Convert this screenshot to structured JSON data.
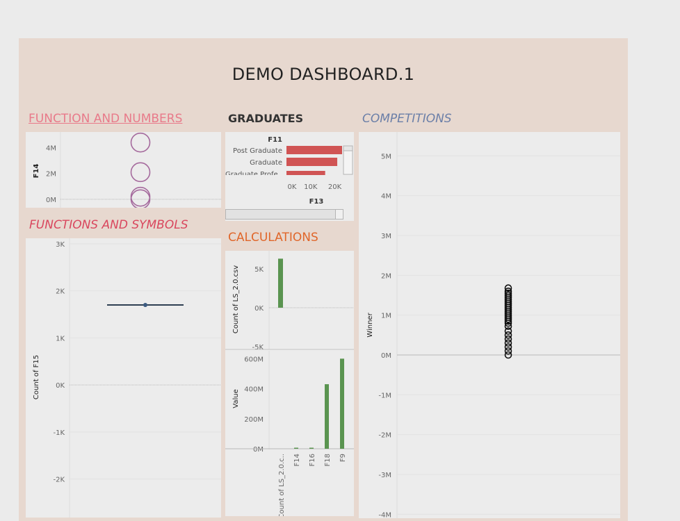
{
  "dashboard": {
    "title": "DEMO DASHBOARD.1"
  },
  "sections": {
    "function_numbers": {
      "title": "FUNCTION AND NUMBERS",
      "color": "#e87a8a"
    },
    "graduates": {
      "title": "GRADUATES",
      "color": "#333333"
    },
    "competitions": {
      "title": "COMPETITIONS",
      "color": "#6b7fa8"
    },
    "functions_symbols": {
      "title": "FUNCTIONS  AND SYMBOLS",
      "color": "#d9475e"
    },
    "calculations": {
      "title": "CALCULATIONS",
      "color": "#e0662a"
    }
  },
  "colors": {
    "ring": "#a56a9d",
    "bar_red": "#d05454",
    "bar_green": "#5a9450",
    "line": "#2e3f52"
  },
  "chart_data": [
    {
      "id": "f14",
      "type": "scatter",
      "ylabel": "F14",
      "y_ticks": [
        "4M",
        "2M",
        "0M"
      ],
      "points": [
        {
          "y": 4.4
        },
        {
          "y": 2.1
        },
        {
          "y": 0.2
        },
        {
          "y": 0.0
        }
      ],
      "y_unit": "M",
      "ylim": [
        -0.6,
        5.0
      ]
    },
    {
      "id": "graduates",
      "type": "bar",
      "orientation": "horizontal",
      "header": "F11",
      "xlabel": "F13",
      "categories": [
        "Post Graduate",
        "Graduate",
        "Graduate Profe.."
      ],
      "values": [
        23000,
        21000,
        16000
      ],
      "x_ticks": [
        "0K",
        "10K",
        "20K"
      ],
      "xlim": [
        0,
        23000
      ]
    },
    {
      "id": "f15",
      "type": "line",
      "ylabel": "Count of F15",
      "y_ticks": [
        "3K",
        "2K",
        "1K",
        "0K",
        "-1K",
        "-2K"
      ],
      "value": 1700,
      "ylim": [
        -2700,
        3000
      ]
    },
    {
      "id": "count_ls",
      "type": "bar",
      "ylabel": "Count of LS_2.0.csv",
      "y_ticks": [
        "5K",
        "0K",
        "-5K"
      ],
      "values": [
        6300
      ],
      "ylim": [
        -5000,
        6600
      ]
    },
    {
      "id": "value",
      "type": "bar",
      "ylabel": "Value",
      "y_ticks": [
        "600M",
        "400M",
        "200M",
        "0M"
      ],
      "categories": [
        "Count of LS_2.0.c..",
        "F14",
        "F16",
        "F18",
        "F9"
      ],
      "values": [
        0,
        6,
        3,
        430,
        600
      ],
      "ylim": [
        0,
        620
      ]
    },
    {
      "id": "winner",
      "type": "scatter",
      "ylabel": "Winner",
      "y_ticks": [
        "5M",
        "4M",
        "3M",
        "2M",
        "1M",
        "0M",
        "-1M",
        "-2M",
        "-3M",
        "-4M"
      ],
      "points_y": [
        1.68,
        1.6,
        1.55,
        1.5,
        1.45,
        1.4,
        1.35,
        1.3,
        1.25,
        1.2,
        1.15,
        1.1,
        1.05,
        1.0,
        0.95,
        0.9,
        0.85,
        0.8,
        0.72,
        0.6,
        0.5,
        0.4,
        0.3,
        0.2,
        0.1,
        0.0
      ],
      "ylim": [
        -4.1,
        5.6
      ]
    }
  ]
}
